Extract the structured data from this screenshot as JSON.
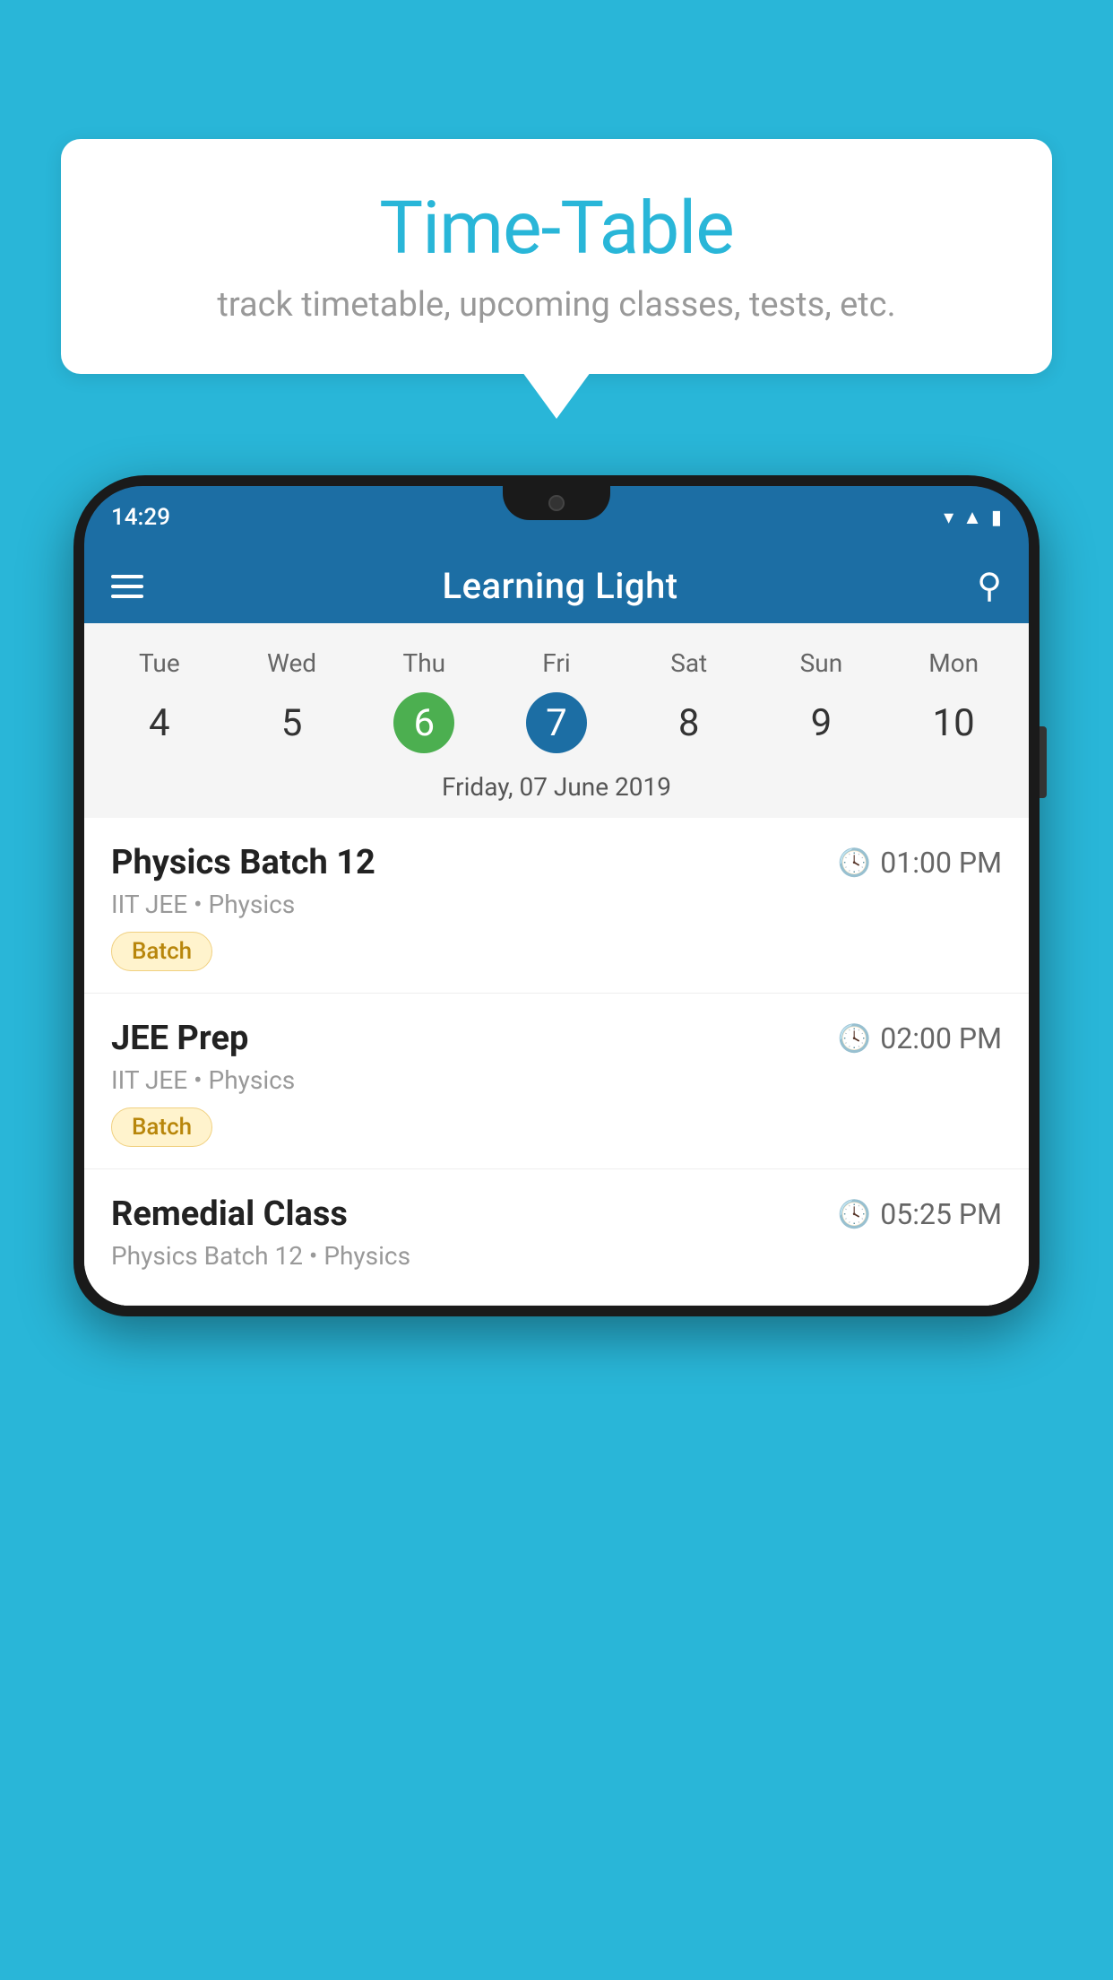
{
  "background_color": "#29B6D8",
  "speech_bubble": {
    "title": "Time-Table",
    "subtitle": "track timetable, upcoming classes, tests, etc."
  },
  "phone": {
    "status_bar": {
      "time": "14:29"
    },
    "app_header": {
      "title": "Learning Light"
    },
    "calendar": {
      "days": [
        "Tue",
        "Wed",
        "Thu",
        "Fri",
        "Sat",
        "Sun",
        "Mon"
      ],
      "dates": [
        "4",
        "5",
        "6",
        "7",
        "8",
        "9",
        "10"
      ],
      "today_index": 2,
      "selected_index": 3,
      "selected_date_label": "Friday, 07 June 2019"
    },
    "classes": [
      {
        "name": "Physics Batch 12",
        "time": "01:00 PM",
        "meta": "IIT JEE • Physics",
        "badge": "Batch"
      },
      {
        "name": "JEE Prep",
        "time": "02:00 PM",
        "meta": "IIT JEE • Physics",
        "badge": "Batch"
      },
      {
        "name": "Remedial Class",
        "time": "05:25 PM",
        "meta": "Physics Batch 12 • Physics",
        "badge": ""
      }
    ]
  }
}
